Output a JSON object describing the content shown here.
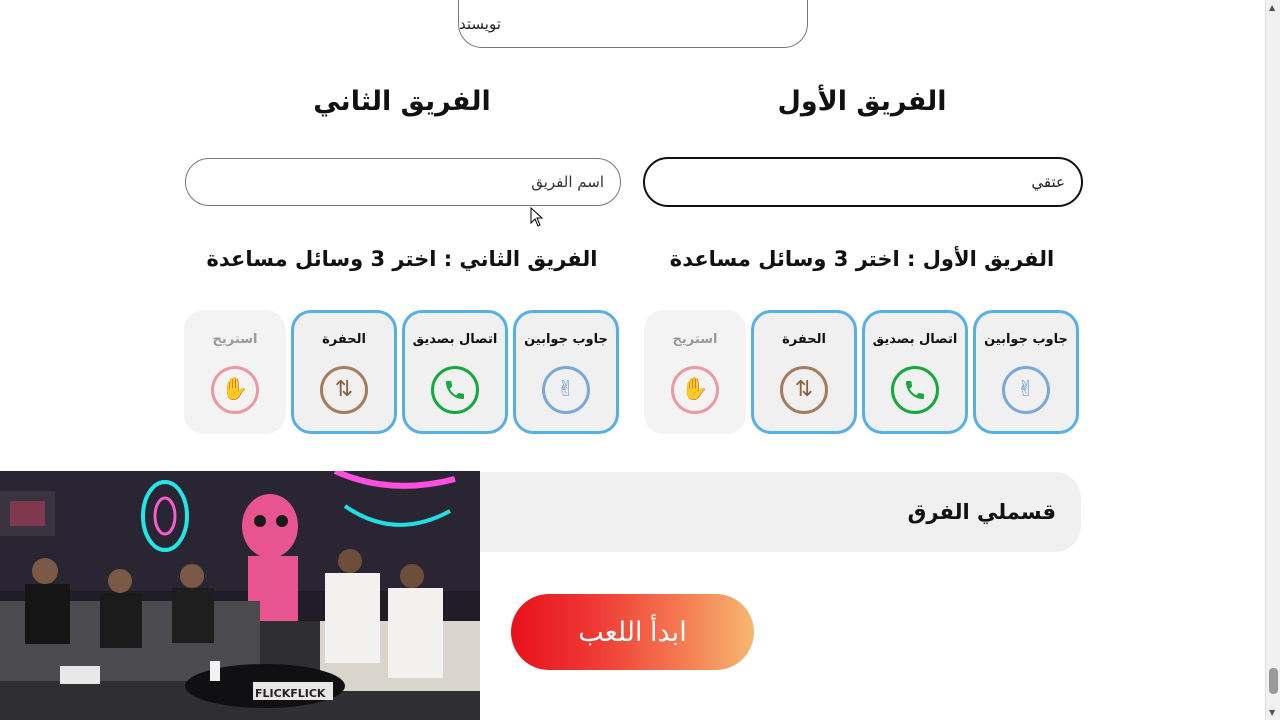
{
  "category_input": {
    "value": "تويستد"
  },
  "team1": {
    "title": "الفريق الأول",
    "name_value": "عتقي",
    "choose_title": "الفريق الأول : اختر 3 وسائل مساعدة",
    "lifelines": [
      {
        "label": "جاوب جوابين",
        "icon": "peace-hand-icon",
        "selected": true
      },
      {
        "label": "اتصال بصديق",
        "icon": "phone-icon",
        "selected": true
      },
      {
        "label": "الحفرة",
        "icon": "swap-arrows-icon",
        "selected": true
      },
      {
        "label": "استريح",
        "icon": "stop-hand-icon",
        "selected": false
      }
    ]
  },
  "team2": {
    "title": "الفريق الثاني",
    "name_placeholder": "اسم الفريق",
    "choose_title": "الفريق الثاني : اختر 3 وسائل مساعدة",
    "lifelines": [
      {
        "label": "جاوب جوابين",
        "icon": "peace-hand-icon",
        "selected": true
      },
      {
        "label": "اتصال بصديق",
        "icon": "phone-icon",
        "selected": true
      },
      {
        "label": "الحفرة",
        "icon": "swap-arrows-icon",
        "selected": true
      },
      {
        "label": "استريح",
        "icon": "stop-hand-icon",
        "selected": false
      }
    ]
  },
  "split_teams": {
    "label": "قسملي الفرق"
  },
  "start_button": {
    "label": "ابدأ اللعب"
  },
  "video": {
    "sign_text": "FLICKFLICK"
  },
  "colors": {
    "selected_border": "#56b0e6",
    "start_gradient_from": "#e8111b",
    "start_gradient_to": "#f6b870"
  }
}
